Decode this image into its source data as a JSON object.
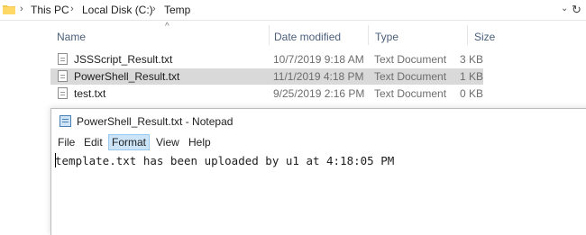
{
  "address": {
    "crumbs": [
      "This PC",
      "Local Disk (C:)",
      "Temp"
    ],
    "separator": "›",
    "dropdown": "⌄",
    "refresh": "↻"
  },
  "columns": {
    "name": "Name",
    "date": "Date modified",
    "type": "Type",
    "size": "Size",
    "sort_indicator": "^"
  },
  "files": [
    {
      "name": "JSSScript_Result.txt",
      "date": "10/7/2019 9:18 AM",
      "type": "Text Document",
      "size": "3 KB",
      "selected": false
    },
    {
      "name": "PowerShell_Result.txt",
      "date": "11/1/2019 4:18 PM",
      "type": "Text Document",
      "size": "1 KB",
      "selected": true
    },
    {
      "name": "test.txt",
      "date": "9/25/2019 2:16 PM",
      "type": "Text Document",
      "size": "0 KB",
      "selected": false
    }
  ],
  "notepad": {
    "title": "PowerShell_Result.txt - Notepad",
    "menu": [
      "File",
      "Edit",
      "Format",
      "View",
      "Help"
    ],
    "active_menu": "Format",
    "content": "template.txt has been uploaded by u1 at 4:18:05 PM"
  },
  "colors": {
    "selection": "#d9d9d9",
    "menu_highlight": "#cce4f7",
    "header_text": "#4c607a"
  }
}
